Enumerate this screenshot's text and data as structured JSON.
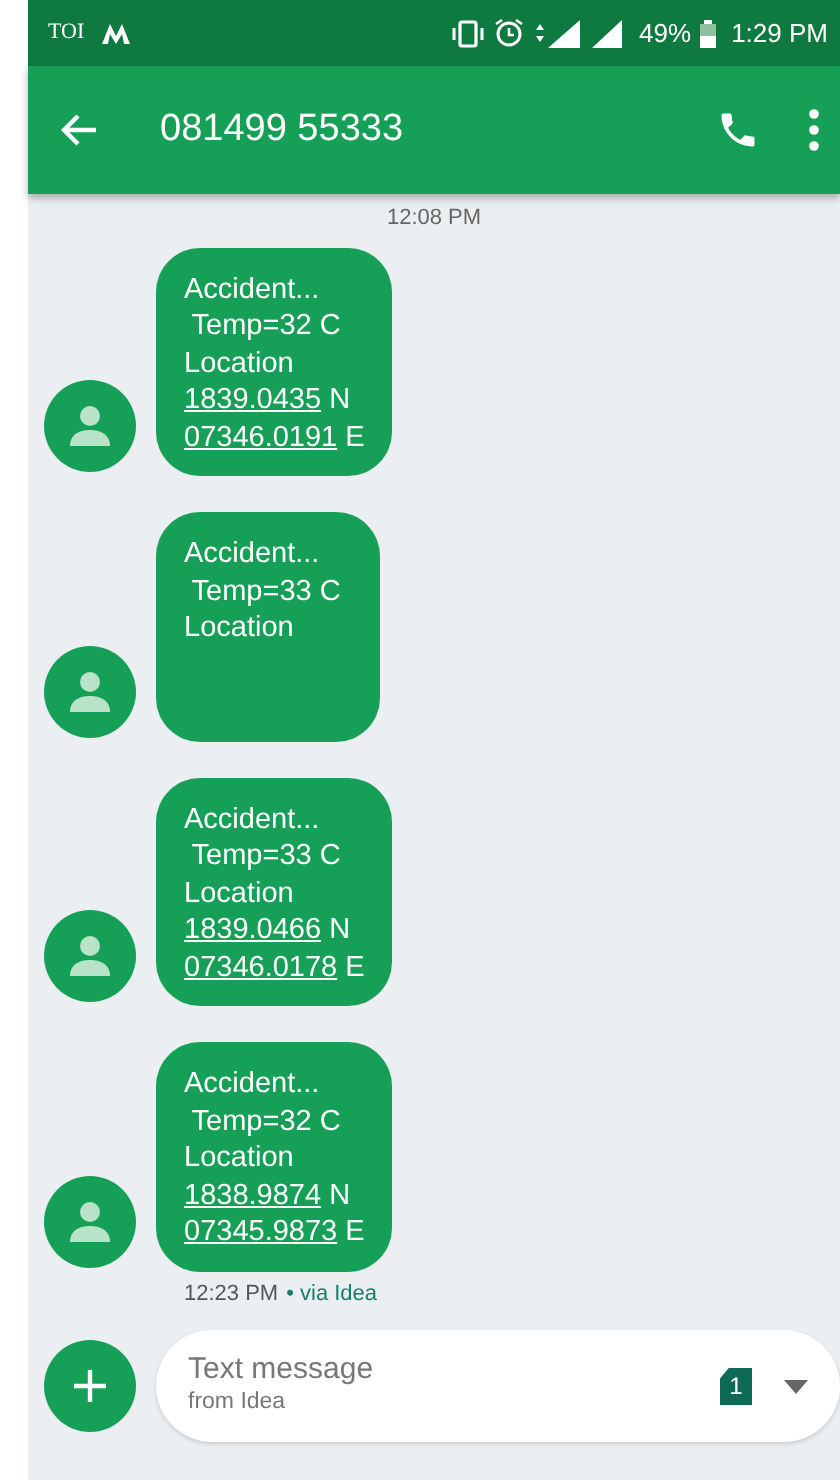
{
  "status_bar": {
    "carrier": "TOI",
    "battery": "49%",
    "time": "1:29 PM"
  },
  "app_bar": {
    "title": "081499 55333"
  },
  "date_divider": "12:08 PM",
  "messages": [
    {
      "lines": [
        {
          "kind": "text",
          "text": "Accident..."
        },
        {
          "kind": "text",
          "text": " Temp=32 C"
        },
        {
          "kind": "text",
          "text": "Location"
        },
        {
          "kind": "coord",
          "value": "1839.0435",
          "suffix": " N"
        },
        {
          "kind": "coord",
          "value": "07346.0191",
          "suffix": " E"
        }
      ]
    },
    {
      "lines": [
        {
          "kind": "text",
          "text": "Accident..."
        },
        {
          "kind": "text",
          "text": " Temp=33 C"
        },
        {
          "kind": "text",
          "text": "Location"
        },
        {
          "kind": "blank"
        },
        {
          "kind": "blank"
        }
      ]
    },
    {
      "lines": [
        {
          "kind": "text",
          "text": "Accident..."
        },
        {
          "kind": "text",
          "text": " Temp=33 C"
        },
        {
          "kind": "text",
          "text": "Location"
        },
        {
          "kind": "coord",
          "value": "1839.0466",
          "suffix": " N"
        },
        {
          "kind": "coord",
          "value": "07346.0178",
          "suffix": " E"
        }
      ]
    },
    {
      "lines": [
        {
          "kind": "text",
          "text": "Accident..."
        },
        {
          "kind": "text",
          "text": " Temp=32 C"
        },
        {
          "kind": "text",
          "text": "Location"
        },
        {
          "kind": "coord",
          "value": "1838.9874",
          "suffix": " N"
        },
        {
          "kind": "coord",
          "value": "07345.9873",
          "suffix": " E"
        }
      ],
      "time": "12:23 PM",
      "via": "• via Idea"
    }
  ],
  "composer": {
    "placeholder": "Text message",
    "sub_label": "from Idea",
    "sim": "1"
  }
}
